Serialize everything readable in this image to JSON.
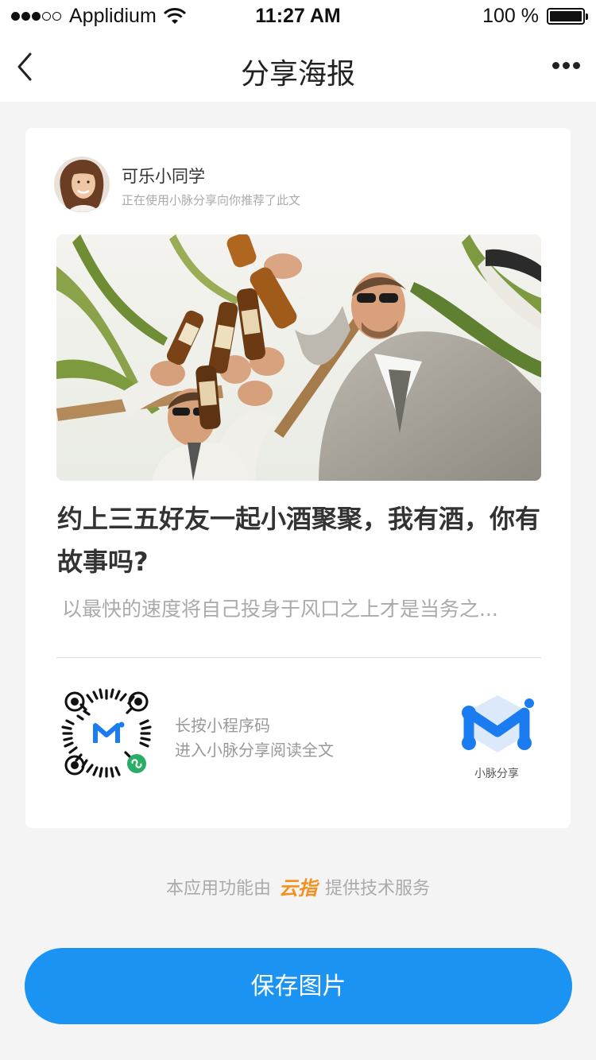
{
  "status_bar": {
    "carrier": "Applidium",
    "time": "11:27 AM",
    "battery": "100 %",
    "signal_level": 3,
    "signal_max": 5
  },
  "nav": {
    "title": "分享海报",
    "back_icon": "chevron-left-icon",
    "more_icon": "more-dots-icon"
  },
  "share": {
    "user_name": "可乐小同学",
    "user_subtitle": "正在使用小脉分享向你推荐了此文"
  },
  "article": {
    "title": "约上三五好友一起小酒聚聚，我有酒，你有故事吗?",
    "description": "以最快的速度将自己投身于风口之上才是当务之..."
  },
  "qr": {
    "hint_line1": "长按小程序码",
    "hint_line2": "进入小脉分享阅读全文"
  },
  "brand": {
    "name": "小脉分享",
    "color": "#1a7cf0"
  },
  "footer": {
    "credit_prefix": "本应用功能由",
    "credit_brand": "云指",
    "credit_suffix": "提供技术服务"
  },
  "actions": {
    "save_label": "保存图片"
  },
  "colors": {
    "accent": "#1a93f2",
    "credit_brand": "#f4901e"
  }
}
